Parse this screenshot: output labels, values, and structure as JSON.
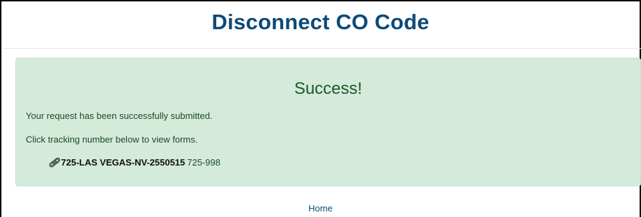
{
  "header": {
    "title": "Disconnect CO Code"
  },
  "alert": {
    "heading": "Success!",
    "message": "Your request has been successfully submitted.",
    "instruction": "Click tracking number below to view forms.",
    "tracking": {
      "icon": "link-icon",
      "number": "725-LAS VEGAS-NV-2550515",
      "code": "725-998"
    }
  },
  "footer": {
    "home_label": "Home"
  },
  "colors": {
    "title": "#0d4a78",
    "alert_background": "#d4eadb",
    "alert_text": "#1d4a25"
  }
}
